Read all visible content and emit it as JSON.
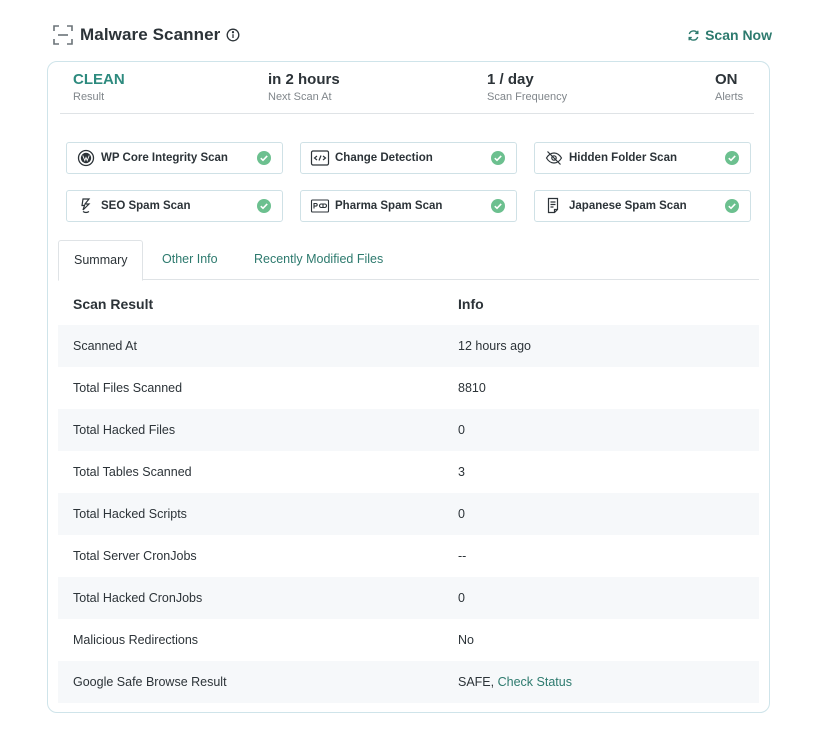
{
  "header": {
    "title": "Malware Scanner",
    "scan_now_label": "Scan Now"
  },
  "stats": [
    {
      "value": "CLEAN",
      "label": "Result"
    },
    {
      "value": "in 2 hours",
      "label": "Next Scan At"
    },
    {
      "value": "1 / day",
      "label": "Scan Frequency"
    },
    {
      "value": "ON",
      "label": "Alerts"
    }
  ],
  "scans": [
    {
      "label": "WP Core Integrity Scan",
      "icon": "wordpress-icon",
      "status": "passed"
    },
    {
      "label": "Change Detection",
      "icon": "code-icon",
      "status": "passed"
    },
    {
      "label": "Hidden Folder Scan",
      "icon": "eye-off-icon",
      "status": "passed"
    },
    {
      "label": "SEO Spam Scan",
      "icon": "spam-bolt-icon",
      "status": "passed"
    },
    {
      "label": "Pharma Spam Scan",
      "icon": "pill-icon",
      "status": "passed"
    },
    {
      "label": "Japanese Spam Scan",
      "icon": "document-icon",
      "status": "passed"
    }
  ],
  "tabs": [
    {
      "label": "Summary",
      "active": true
    },
    {
      "label": "Other Info",
      "active": false
    },
    {
      "label": "Recently Modified Files",
      "active": false
    }
  ],
  "table": {
    "headers": [
      "Scan Result",
      "Info"
    ],
    "rows": [
      {
        "key": "Scanned At",
        "value": "12 hours ago"
      },
      {
        "key": "Total Files Scanned",
        "value": "8810"
      },
      {
        "key": "Total Hacked Files",
        "value": "0"
      },
      {
        "key": "Total Tables Scanned",
        "value": "3"
      },
      {
        "key": "Total Hacked Scripts",
        "value": "0"
      },
      {
        "key": "Total Server CronJobs",
        "value": "--"
      },
      {
        "key": "Total Hacked CronJobs",
        "value": "0"
      },
      {
        "key": "Malicious Redirections",
        "value": "No"
      },
      {
        "key": "Google Safe Browse Result",
        "value": "SAFE,",
        "link": "Check Status"
      }
    ]
  },
  "colors": {
    "accent": "#2d7a6e",
    "clean": "#2d8a7e",
    "check": "#6cc08f",
    "card_border": "#cfe4ea"
  }
}
